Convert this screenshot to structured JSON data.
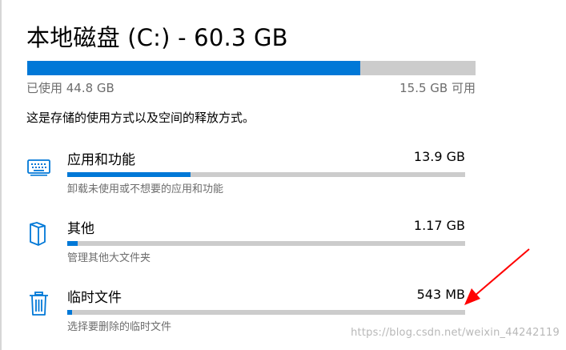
{
  "header": {
    "title": "本地磁盘 (C:) - 60.3 GB"
  },
  "usage": {
    "used_fraction": 0.743,
    "used_label": "已使用 44.8 GB",
    "free_label": "15.5 GB 可用",
    "description": "这是存储的使用方式以及空间的释放方式。"
  },
  "categories": [
    {
      "name": "应用和功能",
      "size": "13.9 GB",
      "fraction": 0.31,
      "subtitle": "卸载未使用或不想要的应用和功能",
      "icon": "keyboard-icon"
    },
    {
      "name": "其他",
      "size": "1.17 GB",
      "fraction": 0.026,
      "subtitle": "管理其他大文件夹",
      "icon": "folder-icon"
    },
    {
      "name": "临时文件",
      "size": "543 MB",
      "fraction": 0.012,
      "subtitle": "选择要删除的临时文件",
      "icon": "trash-icon"
    }
  ],
  "annotation": {
    "arrow_color": "#ff0000"
  },
  "watermark": "https://blog.csdn.net/weixin_44242119",
  "colors": {
    "accent": "#0078d7",
    "track": "#cccccc",
    "secondary_text": "#6d6d6d"
  }
}
